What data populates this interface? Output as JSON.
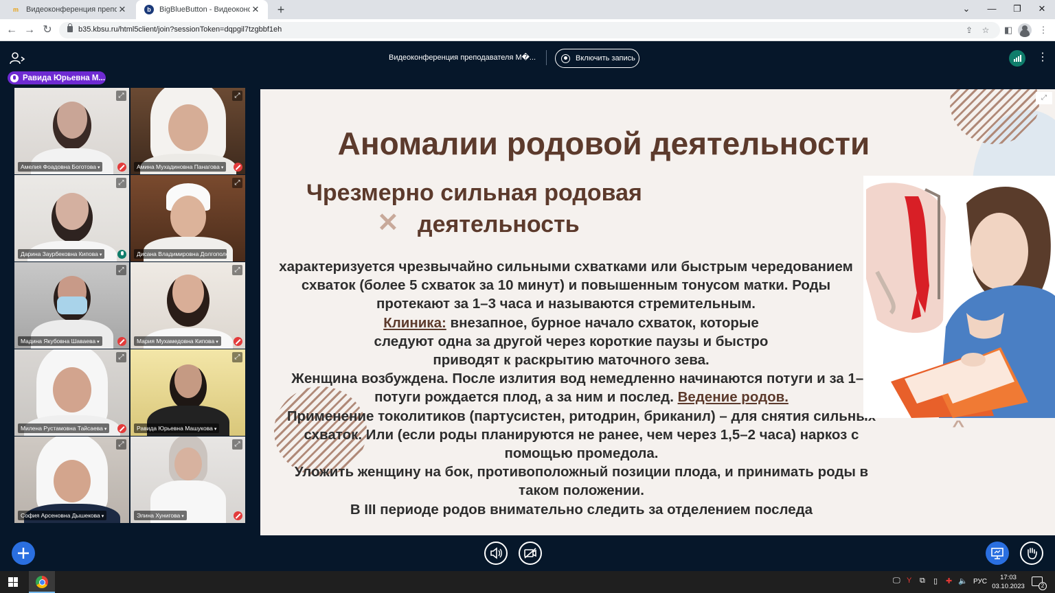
{
  "browser": {
    "tabs": [
      {
        "title": "Видеоконференция преподава",
        "favicon": "moodle-icon",
        "active": false
      },
      {
        "title": "BigBlueButton - Видеоконфере",
        "favicon": "bigbluebutton-icon",
        "active": true
      }
    ],
    "url": "b35.kbsu.ru/html5client/join?sessionToken=dqpgil7tzgbbf1eh"
  },
  "meeting": {
    "title": "Видеоконференция преподавателя М�...",
    "record_label": "Включить запись",
    "talking_user": "Равида Юрьевна М...",
    "colors": {
      "background": "#06172a",
      "accent": "#2a6fe0",
      "talking": "#6e2ad2",
      "connection": "#0f7d6b"
    }
  },
  "webcams": [
    {
      "name": "Амелия Фоадовна Боготова",
      "status": "muted"
    },
    {
      "name": "Амина Мухадиновна Панагова",
      "status": "muted"
    },
    {
      "name": "Дарина Заурбековна Кипова",
      "status": "talking"
    },
    {
      "name": "Дисана Владимировна Долгополова",
      "status": "none"
    },
    {
      "name": "Мадина Якубовна Шаваева",
      "status": "muted"
    },
    {
      "name": "Мария Мухамедовна Кипова",
      "status": "muted"
    },
    {
      "name": "Милена Рустамовна Тайсаева",
      "status": "muted"
    },
    {
      "name": "Равида Юрьевна Машукова",
      "status": "none"
    },
    {
      "name": "София Арсеновна Дышекова",
      "status": "none"
    },
    {
      "name": "Элина Хунигова",
      "status": "muted"
    }
  ],
  "slide": {
    "title": "Аномалии родовой деятельности",
    "subtitle_line1": "Чрезмерно сильная родовая",
    "subtitle_line2": "деятельность",
    "p1": "характеризуется чрезвычайно сильными схватками или быстрым чередованием схваток (более 5 схваток за 10 минут) и повышенным тонусом матки. Роды протекают за 1–3 часа и называются стремительным.",
    "clinic_label": "Клиника:",
    "clinic_text": " внезапное, бурное начало схваток, которые следуют одна за другой через короткие паузы и быстро приводят к раскрытию маточного зева.",
    "p3": "Женщина возбуждена. После излития вод немедленно начинаются потуги и за 1–2 потуги рождается плод, а за ним и послед. ",
    "management_label": "Ведение родов.",
    "p4": "Применение токолитиков (партусистен, ритодрин, бриканил) – для снятия сильных схваток. Или (если роды планируются не ранее, чем через 1,5–2 часа) наркоз с помощью промедола.",
    "p5": "Уложить женщину на бок, противоположный позиции плода, и принимать роды в таком положении.",
    "p6": "В III периоде родов внимательно следить за отделением последа"
  },
  "taskbar": {
    "lang": "РУС",
    "time": "17:03",
    "date": "03.10.2023",
    "notifications": "2"
  }
}
